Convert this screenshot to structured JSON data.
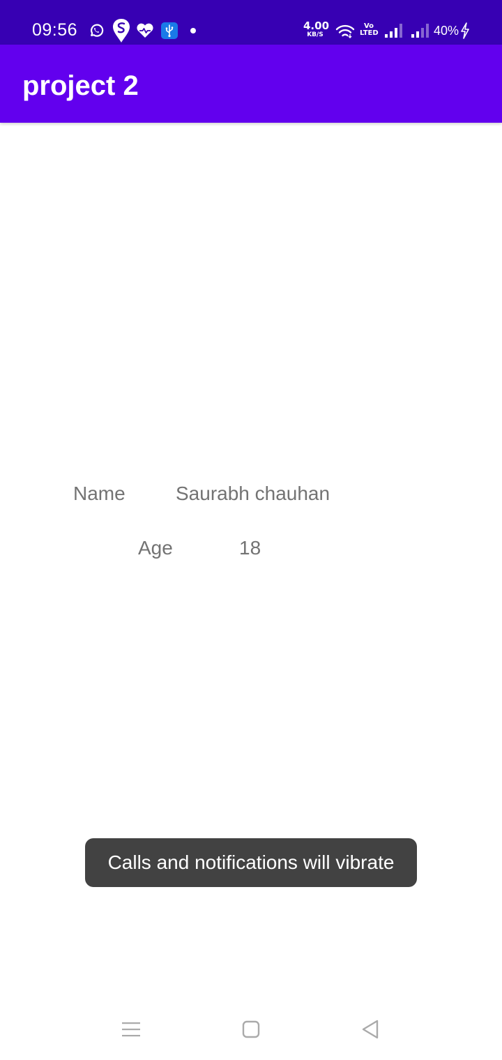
{
  "status_bar": {
    "time": "09:56",
    "net_speed_value": "4.00",
    "net_speed_unit": "KB/S",
    "volte_top": "Vo",
    "volte_bottom": "LTED",
    "battery": "40%",
    "background": "#3700b3",
    "icons": [
      "whatsapp-icon",
      "swiggy-icon",
      "health-heart-icon",
      "usb-icon",
      "notification-dot-icon",
      "wifi-icon",
      "signal-icon",
      "signal-icon",
      "battery-charging-icon"
    ]
  },
  "app_bar": {
    "title": "project 2",
    "background": "#6200ee"
  },
  "content": {
    "name_label": "Name",
    "name_value": "Saurabh chauhan",
    "age_label": "Age",
    "age_value": "18",
    "text_color": "#737373"
  },
  "toast": {
    "message": "Calls and notifications will vibrate",
    "background": "#424242"
  },
  "nav_bar": {
    "icons": [
      "menu-icon",
      "home-icon",
      "back-icon"
    ],
    "icon_color": "#aaaaaa"
  }
}
